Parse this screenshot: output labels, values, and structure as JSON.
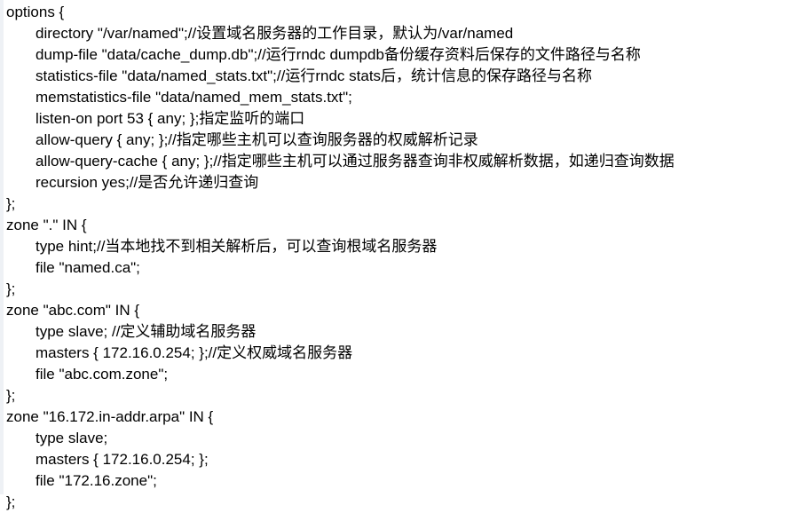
{
  "document": {
    "kind": "text-file-listing",
    "filename_implied": "named.conf",
    "background_color": "#ffffff",
    "text_color": "#000000",
    "left_band_color": "#eef1f5"
  },
  "code": {
    "lines": [
      {
        "indent": 0,
        "text": "options {"
      },
      {
        "indent": 1,
        "text": "directory \"/var/named\";//设置域名服务器的工作目录，默认为/var/named"
      },
      {
        "indent": 1,
        "text": "dump-file \"data/cache_dump.db\";//运行rndc dumpdb备份缓存资料后保存的文件路径与名称"
      },
      {
        "indent": 1,
        "text": "statistics-file \"data/named_stats.txt\";//运行rndc stats后，统计信息的保存路径与名称"
      },
      {
        "indent": 1,
        "text": "memstatistics-file \"data/named_mem_stats.txt\";"
      },
      {
        "indent": 1,
        "text": "listen-on port 53 { any; };指定监听的端口"
      },
      {
        "indent": 1,
        "text": "allow-query { any; };//指定哪些主机可以查询服务器的权威解析记录"
      },
      {
        "indent": 1,
        "text": "allow-query-cache { any; };//指定哪些主机可以通过服务器查询非权威解析数据，如递归查询数据"
      },
      {
        "indent": 1,
        "text": "recursion yes;//是否允许递归查询"
      },
      {
        "indent": 0,
        "text": "};"
      },
      {
        "indent": 0,
        "text": "zone \".\" IN {"
      },
      {
        "indent": 1,
        "text": "type hint;//当本地找不到相关解析后，可以查询根域名服务器"
      },
      {
        "indent": 1,
        "text": "file \"named.ca\";"
      },
      {
        "indent": 0,
        "text": "};"
      },
      {
        "indent": 0,
        "text": "zone \"abc.com\" IN {"
      },
      {
        "indent": 1,
        "text": "type slave; //定义辅助域名服务器"
      },
      {
        "indent": 1,
        "text": "masters { 172.16.0.254; };//定义权威域名服务器"
      },
      {
        "indent": 1,
        "text": "file \"abc.com.zone\";"
      },
      {
        "indent": 0,
        "text": "};"
      },
      {
        "indent": 0,
        "text": "zone \"16.172.in-addr.arpa\" IN {"
      },
      {
        "indent": 1,
        "text": "type slave;"
      },
      {
        "indent": 1,
        "text": "masters { 172.16.0.254; };"
      },
      {
        "indent": 1,
        "text": "file \"172.16.zone\";"
      },
      {
        "indent": 0,
        "text": "};"
      }
    ]
  }
}
